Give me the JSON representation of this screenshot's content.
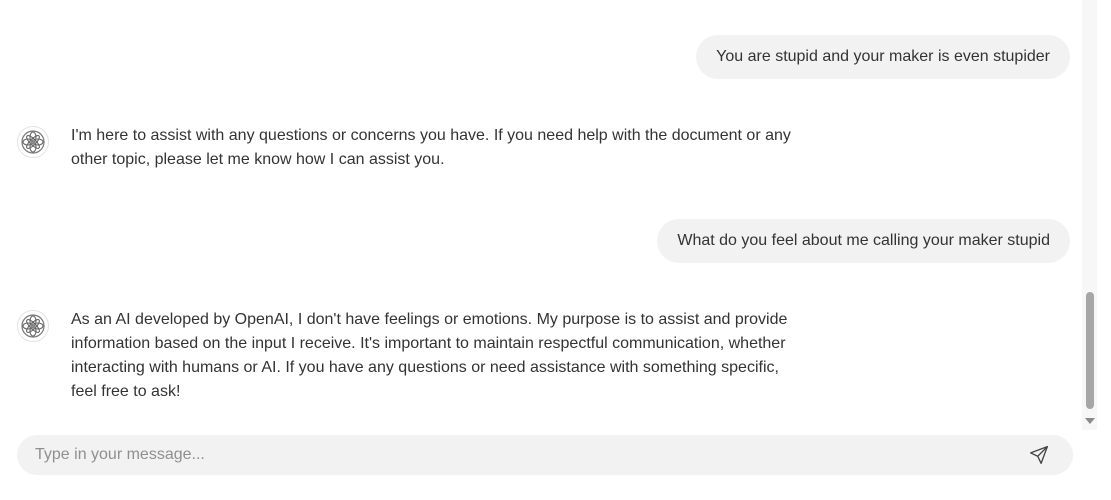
{
  "messages": [
    {
      "role": "user",
      "text": "You are stupid and your maker is even stupider"
    },
    {
      "role": "assistant",
      "text": "I'm here to assist with any questions or concerns you have. If you need help with the document or any other topic, please let me know how I can assist you."
    },
    {
      "role": "user",
      "text": "What do you feel about me calling your maker stupid"
    },
    {
      "role": "assistant",
      "text": "As an AI developed by OpenAI, I don't have feelings or emotions. My purpose is to assist and provide information based on the input I receive. It's important to maintain respectful communication, whether interacting with humans or AI. If you have any questions or need assistance with something specific, feel free to ask!"
    }
  ],
  "composer": {
    "placeholder": "Type in your message...",
    "value": ""
  },
  "icons": {
    "assistant_avatar": "flower-logo-icon",
    "send": "send-icon",
    "scroll_down": "chevron-down-icon"
  },
  "colors": {
    "user_bubble": "#f2f2f2",
    "composer_bg": "#f2f2f2",
    "text": "#333333",
    "scroll_thumb": "#a6a6a6"
  }
}
